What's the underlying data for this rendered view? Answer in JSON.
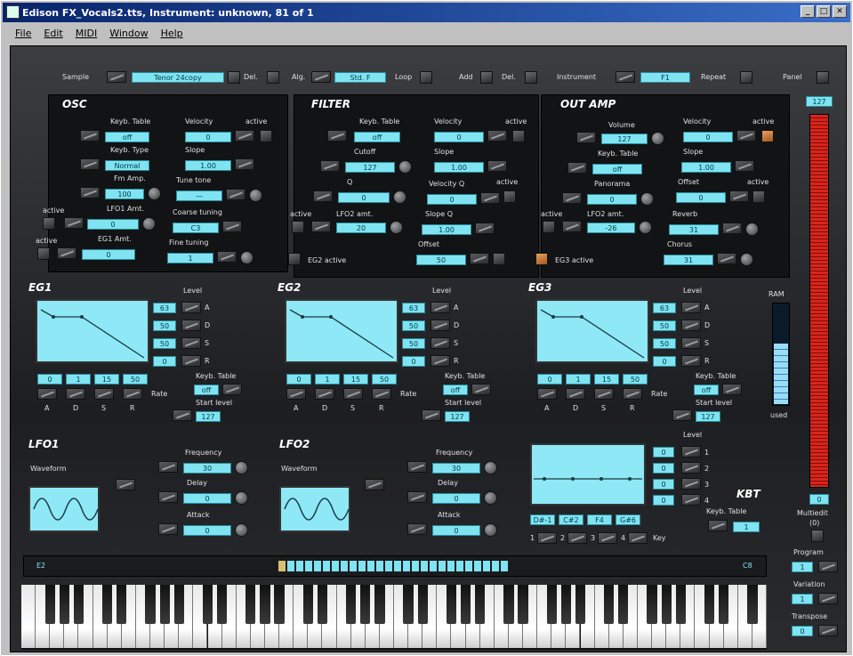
{
  "window": {
    "title": "Edison FX_Vocals2.tts,  Instrument: unknown, 81 of 1",
    "btn_min": "_",
    "btn_max": "□",
    "btn_close": "✕"
  },
  "menu": [
    "File",
    "Edit",
    "MIDI",
    "Window",
    "Help"
  ],
  "topbar": {
    "sample_label": "Sample",
    "sample_value": "Tenor  24copy",
    "del_label": "Del.",
    "alg_label": "Alg.",
    "alg_value": "Std. F",
    "loop_label": "Loop",
    "add_label": "Add",
    "del2_label": "Del.",
    "instrument_label": "Instrument",
    "instrument_value": "F1",
    "repeat_label": "Repeat",
    "panel_label": "Panel"
  },
  "osc": {
    "title": "OSC",
    "keyb_table": "Keyb. Table",
    "keyb_table_val": "off",
    "keyb_type": "Keyb. Type",
    "keyb_type_val": "Normal",
    "fm_amp": "Fm Amp.",
    "fm_amp_val": "100",
    "lfo1_amt": "LFO1 Amt.",
    "lfo1_amt_val": "0",
    "eg1_amt": "EG1 Amt.",
    "eg1_amt_val": "0",
    "active": "active",
    "velocity": "Velocity",
    "velocity_val": "0",
    "slope": "Slope",
    "slope_val": "1.00",
    "tune_tone": "Tune tone",
    "tune_tone_val": "—",
    "coarse_tuning": "Coarse tuning",
    "coarse_val": "C3",
    "fine_tuning": "Fine tuning",
    "fine_val": "1"
  },
  "filter": {
    "title": "FILTER",
    "keyb_table": "Keyb. Table",
    "keyb_table_val": "off",
    "cutoff": "Cutoff",
    "cutoff_val": "127",
    "q": "Q",
    "q_val": "0",
    "lfo2_amt": "LFO2 amt.",
    "lfo2_amt_val": "20",
    "velocity": "Velocity",
    "velocity_val": "0",
    "slope": "Slope",
    "slope_val": "1.00",
    "velocity_q": "Velocity Q",
    "velocity_q_val": "0",
    "slope_q": "Slope Q",
    "slope_q_val": "1.00",
    "offset": "Offset",
    "offset_val": "50",
    "eg2_active": "EG2 active",
    "active": "active"
  },
  "outamp": {
    "title": "OUT AMP",
    "volume": "Volume",
    "volume_val": "127",
    "keyb_table": "Keyb. Table",
    "keyb_table_val": "off",
    "panorama": "Panorama",
    "panorama_val": "0",
    "lfo2_amt": "LFO2 amt.",
    "lfo2_amt_val": "-26",
    "velocity": "Velocity",
    "velocity_val": "0",
    "slope": "Slope",
    "slope_val": "1.00",
    "offset": "Offset",
    "offset_val": "0",
    "reverb": "Reverb",
    "reverb_val": "31",
    "chorus": "Chorus",
    "chorus_val": "31",
    "eg3_active": "EG3 active",
    "active": "active"
  },
  "eg1": {
    "title": "EG1",
    "level": "Level",
    "levels": [
      "63",
      "50",
      "50",
      "0"
    ],
    "lvl_names": [
      "A",
      "D",
      "S",
      "R"
    ],
    "rates": [
      "0",
      "1",
      "15",
      "50"
    ],
    "rate_label": "Rate",
    "keyb_table": "Keyb. Table",
    "keyb_val": "off",
    "start_level": "Start level",
    "start_val": "127"
  },
  "eg2": {
    "title": "EG2",
    "level": "Level",
    "levels": [
      "63",
      "50",
      "50",
      "0"
    ],
    "lvl_names": [
      "A",
      "D",
      "S",
      "R"
    ],
    "rates": [
      "0",
      "1",
      "15",
      "50"
    ],
    "rate_label": "Rate",
    "keyb_table": "Keyb. Table",
    "keyb_val": "off",
    "start_level": "Start level",
    "start_val": "127"
  },
  "eg3": {
    "title": "EG3",
    "level": "Level",
    "levels": [
      "63",
      "50",
      "50",
      "0"
    ],
    "lvl_names": [
      "A",
      "D",
      "S",
      "R"
    ],
    "rates": [
      "0",
      "1",
      "15",
      "50"
    ],
    "rate_label": "Rate",
    "keyb_table": "Keyb. Table",
    "keyb_val": "off",
    "start_level": "Start level",
    "start_val": "127"
  },
  "lfo1": {
    "title": "LFO1",
    "waveform": "Waveform",
    "frequency": "Frequency",
    "freq_val": "30",
    "delay": "Delay",
    "delay_val": "0",
    "attack": "Attack",
    "attack_val": "0"
  },
  "lfo2": {
    "title": "LFO2",
    "waveform": "Waveform",
    "frequency": "Frequency",
    "freq_val": "30",
    "delay": "Delay",
    "delay_val": "0",
    "attack": "Attack",
    "attack_val": "0"
  },
  "kbt": {
    "title": "KBT",
    "level": "Level",
    "levels": [
      "0",
      "0",
      "0",
      "0"
    ],
    "lvl_nums": [
      "1",
      "2",
      "3",
      "4"
    ],
    "keys": [
      "D#-1",
      "C#2",
      "F4",
      "G#6"
    ],
    "key_label": "Key",
    "key_nums": [
      "1",
      "2",
      "3",
      "4"
    ],
    "keyb_table": "Keyb. Table",
    "keyb_val": "1"
  },
  "ram": {
    "label": "RAM",
    "used": "used",
    "level_fraction": 0.6
  },
  "right": {
    "meter_top": "127",
    "meter_bottom": "0",
    "meter_fraction": 1.0,
    "multiedit": "Multiedit",
    "multiedit_sub": "(0)",
    "program": "Program",
    "program_val": "1",
    "variation": "Variation",
    "variation_val": "1",
    "transpose": "Transpose",
    "transpose_val": "0"
  },
  "keyboard": {
    "left_note": "E2",
    "right_note": "C8",
    "white_keys": 52
  }
}
